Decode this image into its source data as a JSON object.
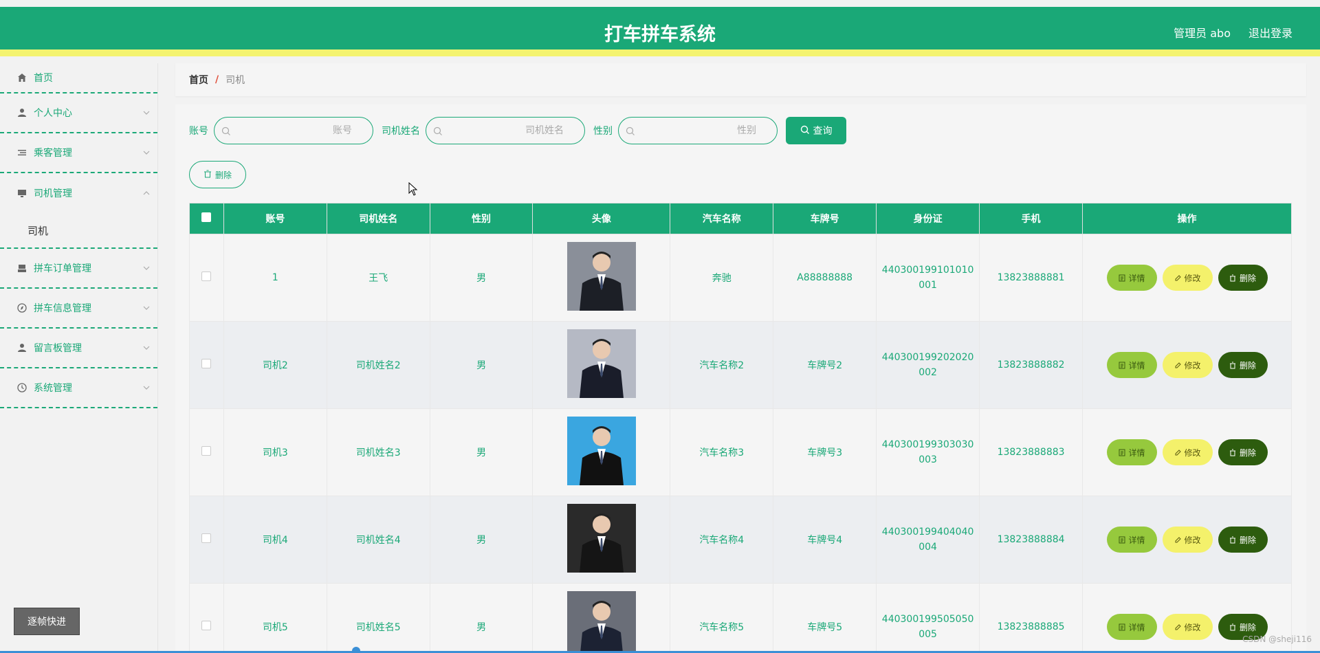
{
  "header": {
    "title": "打车拼车系统",
    "user": "管理员 abo",
    "logout": "退出登录"
  },
  "sidebar": {
    "items": [
      {
        "label": "首页",
        "icon": "home-icon"
      },
      {
        "label": "个人中心",
        "icon": "user-icon"
      },
      {
        "label": "乘客管理",
        "icon": "list-icon"
      },
      {
        "label": "司机管理",
        "icon": "monitor-icon"
      },
      {
        "label": "拼车订单管理",
        "icon": "archive-icon"
      },
      {
        "label": "拼车信息管理",
        "icon": "compass-icon"
      },
      {
        "label": "留言板管理",
        "icon": "user-icon"
      },
      {
        "label": "系统管理",
        "icon": "clock-icon"
      }
    ],
    "submenu": "司机",
    "frame_button": "逐帧快进"
  },
  "breadcrumb": {
    "home": "首页",
    "sep": "/",
    "current": "司机"
  },
  "search": {
    "account_label": "账号",
    "account_placeholder": "账号",
    "name_label": "司机姓名",
    "name_placeholder": "司机姓名",
    "gender_label": "性别",
    "gender_placeholder": "性别",
    "query": "查询",
    "delete": "删除"
  },
  "table": {
    "headers": [
      "账号",
      "司机姓名",
      "性别",
      "头像",
      "汽车名称",
      "车牌号",
      "身份证",
      "手机",
      "操作"
    ],
    "actions": {
      "detail": "详情",
      "edit": "修改",
      "remove": "删除"
    },
    "rows": [
      {
        "account": "1",
        "name": "王飞",
        "gender": "男",
        "car": "奔驰",
        "plate": "A88888888",
        "id_line1": "440300199101010",
        "id_line2": "001",
        "phone": "13823888881"
      },
      {
        "account": "司机2",
        "name": "司机姓名2",
        "gender": "男",
        "car": "汽车名称2",
        "plate": "车牌号2",
        "id_line1": "440300199202020",
        "id_line2": "002",
        "phone": "13823888882"
      },
      {
        "account": "司机3",
        "name": "司机姓名3",
        "gender": "男",
        "car": "汽车名称3",
        "plate": "车牌号3",
        "id_line1": "440300199303030",
        "id_line2": "003",
        "phone": "13823888883"
      },
      {
        "account": "司机4",
        "name": "司机姓名4",
        "gender": "男",
        "car": "汽车名称4",
        "plate": "车牌号4",
        "id_line1": "440300199404040",
        "id_line2": "004",
        "phone": "13823888884"
      },
      {
        "account": "司机5",
        "name": "司机姓名5",
        "gender": "男",
        "car": "汽车名称5",
        "plate": "车牌号5",
        "id_line1": "440300199505050",
        "id_line2": "005",
        "phone": "13823888885"
      }
    ]
  },
  "watermark": "CSDN @sheji116",
  "colors": {
    "primary": "#1aa877",
    "accent_yellow": "#f4f370",
    "detail": "#96c93d",
    "edit": "#f4f16b",
    "remove": "#2d5c0e"
  }
}
